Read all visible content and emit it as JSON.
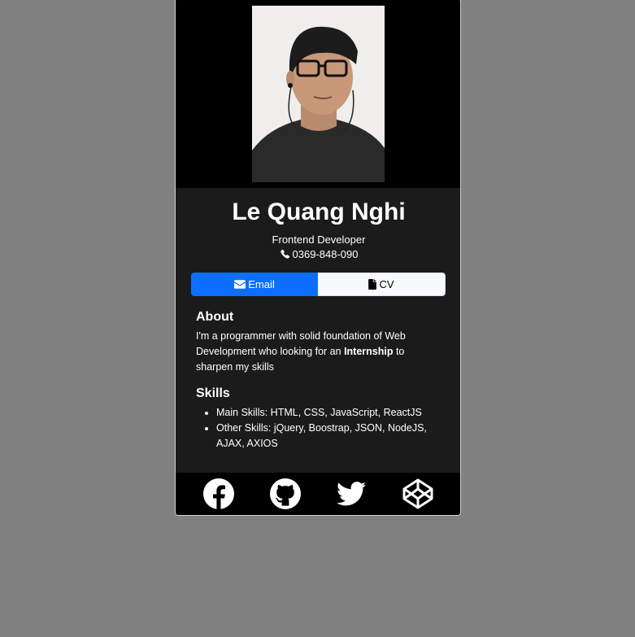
{
  "profile": {
    "name": "Le Quang Nghi",
    "role": "Frontend Developer",
    "phone": "0369-848-090",
    "photo_alt": "profile photo"
  },
  "actions": {
    "email_label": "Email",
    "cv_label": "CV"
  },
  "about": {
    "heading": "About",
    "text_before": "I'm a programmer with solid foundation of Web Development who looking for an ",
    "highlight": "Internship",
    "text_after": " to sharpen my skills"
  },
  "skills": {
    "heading": "Skills",
    "items": [
      "Main Skills: HTML, CSS, JavaScript, ReactJS",
      "Other Skills: jQuery, Boostrap, JSON, NodeJS, AJAX, AXIOS"
    ]
  },
  "social": {
    "icons": [
      "facebook-icon",
      "github-icon",
      "twitter-icon",
      "codepen-icon"
    ]
  },
  "colors": {
    "page_bg": "#808080",
    "card_bg": "#1b1b1b",
    "band_bg": "#000000",
    "primary": "#0d6efd",
    "light": "#f8f9fa"
  }
}
